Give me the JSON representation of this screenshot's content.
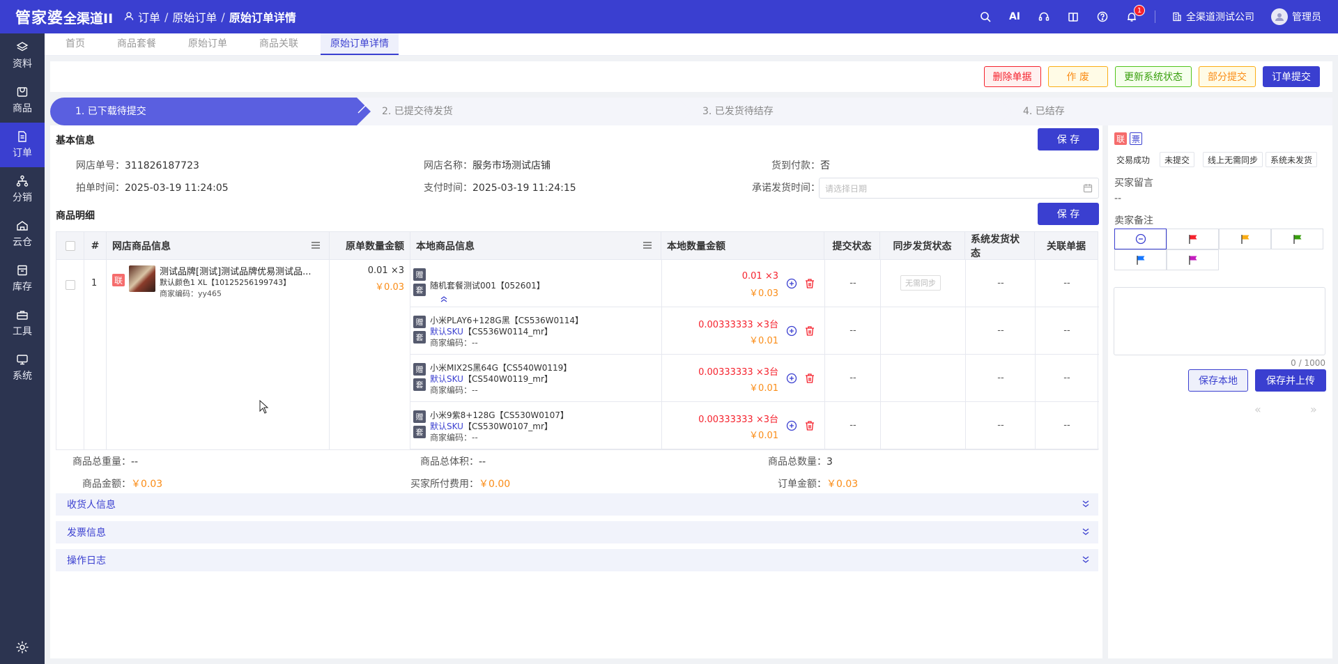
{
  "app": {
    "logo_main": "管家婆",
    "logo_sub": "全渠道II"
  },
  "breadcrumb": {
    "items": [
      "订单",
      "原始订单",
      "原始订单详情"
    ],
    "separator": "/"
  },
  "header": {
    "notification_count": "1",
    "company": "全渠道测试公司",
    "user": "管理员"
  },
  "sidebar": {
    "items": [
      {
        "label": "资料",
        "icon": "layers-icon"
      },
      {
        "label": "商品",
        "icon": "goods-icon"
      },
      {
        "label": "订单",
        "icon": "order-icon"
      },
      {
        "label": "分销",
        "icon": "distribution-icon"
      },
      {
        "label": "云仓",
        "icon": "cloud-warehouse-icon"
      },
      {
        "label": "库存",
        "icon": "inventory-icon"
      },
      {
        "label": "工具",
        "icon": "toolbox-icon"
      },
      {
        "label": "系统",
        "icon": "monitor-icon"
      }
    ],
    "active_index": 2
  },
  "tabs": [
    "首页",
    "商品套餐",
    "原始订单",
    "商品关联",
    "原始订单详情"
  ],
  "actions": {
    "delete": "删除单据",
    "void": "作 废",
    "update_status": "更新系统状态",
    "partial_submit": "部分提交",
    "submit": "订单提交"
  },
  "steps": [
    "1. 已下载待提交",
    "2. 已提交待发货",
    "3. 已发货待结存",
    "4. 已结存"
  ],
  "basic": {
    "title": "基本信息",
    "save": "保 存",
    "shop_order_label": "网店单号：",
    "shop_order_value": "311826187723",
    "shop_name_label": "网店名称：",
    "shop_name_value": "服务市场测试店铺",
    "cod_label": "货到付款：",
    "cod_value": "否",
    "order_time_label": "拍单时间：",
    "order_time_value": "2025-03-19 11:24:05",
    "pay_time_label": "支付时间：",
    "pay_time_value": "2025-03-19 11:24:15",
    "promise_label": "承诺发货时间：",
    "promise_placeholder": "请选择日期"
  },
  "detail": {
    "title": "商品明细",
    "save": "保 存",
    "headers": [
      "#",
      "网店商品信息",
      "原单数量金额",
      "本地商品信息",
      "本地数量金额",
      "提交状态",
      "同步发货状态",
      "系统发货状态",
      "关联单据"
    ],
    "row": {
      "index": "1",
      "tag": "联",
      "product_title": "测试品牌[测试]测试品牌优易测试品...",
      "product_spec": "默认颜色1 XL【10125256199743】",
      "merchant_code": "商家编码：yy465",
      "orig_qty": "0.01 ×3",
      "orig_amount": "￥0.03",
      "sync_button": "无需同步",
      "locals": [
        {
          "tag1": "赠",
          "tag2": "套",
          "name": "随机套餐测试001【052601】",
          "sku": "",
          "code": "",
          "qty": "0.01 ×3",
          "amount": "￥0.03",
          "submit": "--",
          "sys": "--",
          "rel": "--"
        },
        {
          "tag1": "赠",
          "tag2": "套",
          "name": "小米PLAY6+128G黑【CS536W0114】",
          "sku_label": "默认SKU",
          "sku": "【CS536W0114_mr】",
          "code": "商家编码：--",
          "qty": "0.00333333 ×3台",
          "amount": "￥0.01",
          "submit": "--",
          "sys": "--",
          "rel": "--"
        },
        {
          "tag1": "赠",
          "tag2": "套",
          "name": "小米MIX2S黑64G【CS540W0119】",
          "sku_label": "默认SKU",
          "sku": "【CS540W0119_mr】",
          "code": "商家编码：--",
          "qty": "0.00333333 ×3台",
          "amount": "￥0.01",
          "submit": "--",
          "sys": "--",
          "rel": "--"
        },
        {
          "tag1": "赠",
          "tag2": "套",
          "name": "小米9紫8+128G【CS530W0107】",
          "sku_label": "默认SKU",
          "sku": "【CS530W0107_mr】",
          "code": "商家编码：--",
          "qty": "0.00333333 ×3台",
          "amount": "￥0.01",
          "submit": "--",
          "sys": "--",
          "rel": "--"
        }
      ]
    }
  },
  "summary": {
    "weight_label": "商品总重量：",
    "weight_value": "--",
    "volume_label": "商品总体积：",
    "volume_value": "--",
    "count_label": "商品总数量：",
    "count_value": "3",
    "goods_amount_label": "商品金额：",
    "goods_amount_value": "￥0.03",
    "buyer_fee_label": "买家所付费用：",
    "buyer_fee_value": "￥0.00",
    "order_amount_label": "订单金额：",
    "order_amount_value": "￥0.03"
  },
  "collapsibles": [
    "收货人信息",
    "发票信息",
    "操作日志"
  ],
  "right": {
    "tag_lian": "联",
    "tag_piao": "票",
    "chips": [
      "交易成功",
      "未提交",
      "线上无需同步",
      "系统未发货"
    ],
    "buyer_msg_label": "买家留言",
    "buyer_msg_value": "--",
    "seller_note_label": "卖家备注",
    "flag_colors": [
      "#f5222d",
      "#faad14",
      "#389e0d",
      "#1677ff",
      "#c41dbf"
    ],
    "counter": "0 / 1000",
    "save_local": "保存本地",
    "save_upload": "保存并上传",
    "prev": "«",
    "next": "»"
  },
  "colors": {
    "brand": "#3a3fd0",
    "sidebar": "#2c3450",
    "price": "#fa8c16",
    "danger": "#f5222d"
  }
}
